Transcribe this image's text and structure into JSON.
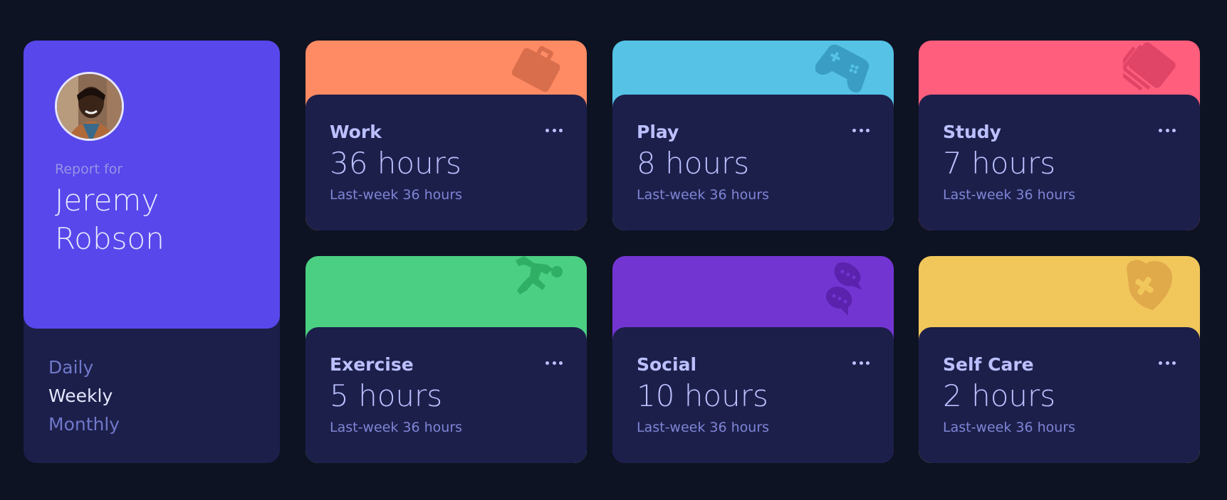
{
  "profile": {
    "report_label": "Report for",
    "name": "Jeremy Robson",
    "avatar_icon": "user-avatar"
  },
  "periods": [
    {
      "label": "Daily",
      "active": false
    },
    {
      "label": "Weekly",
      "active": true
    },
    {
      "label": "Monthly",
      "active": false
    }
  ],
  "activities": [
    {
      "title": "Work",
      "hours": "36 hours",
      "previous": "Last-week 36 hours",
      "color": "#ff8b64",
      "icon": "briefcase-icon"
    },
    {
      "title": "Play",
      "hours": "8 hours",
      "previous": "Last-week 36 hours",
      "color": "#55c2e6",
      "icon": "gamepad-icon"
    },
    {
      "title": "Study",
      "hours": "7 hours",
      "previous": "Last-week 36 hours",
      "color": "#ff5e7d",
      "icon": "book-icon"
    },
    {
      "title": "Exercise",
      "hours": "5 hours",
      "previous": "Last-week 36 hours",
      "color": "#4bcf82",
      "icon": "running-icon"
    },
    {
      "title": "Social",
      "hours": "10 hours",
      "previous": "Last-week 36 hours",
      "color": "#7335d2",
      "icon": "chat-icon"
    },
    {
      "title": "Self Care",
      "hours": "2 hours",
      "previous": "Last-week 36 hours",
      "color": "#f1c75b",
      "icon": "heart-icon"
    }
  ]
}
